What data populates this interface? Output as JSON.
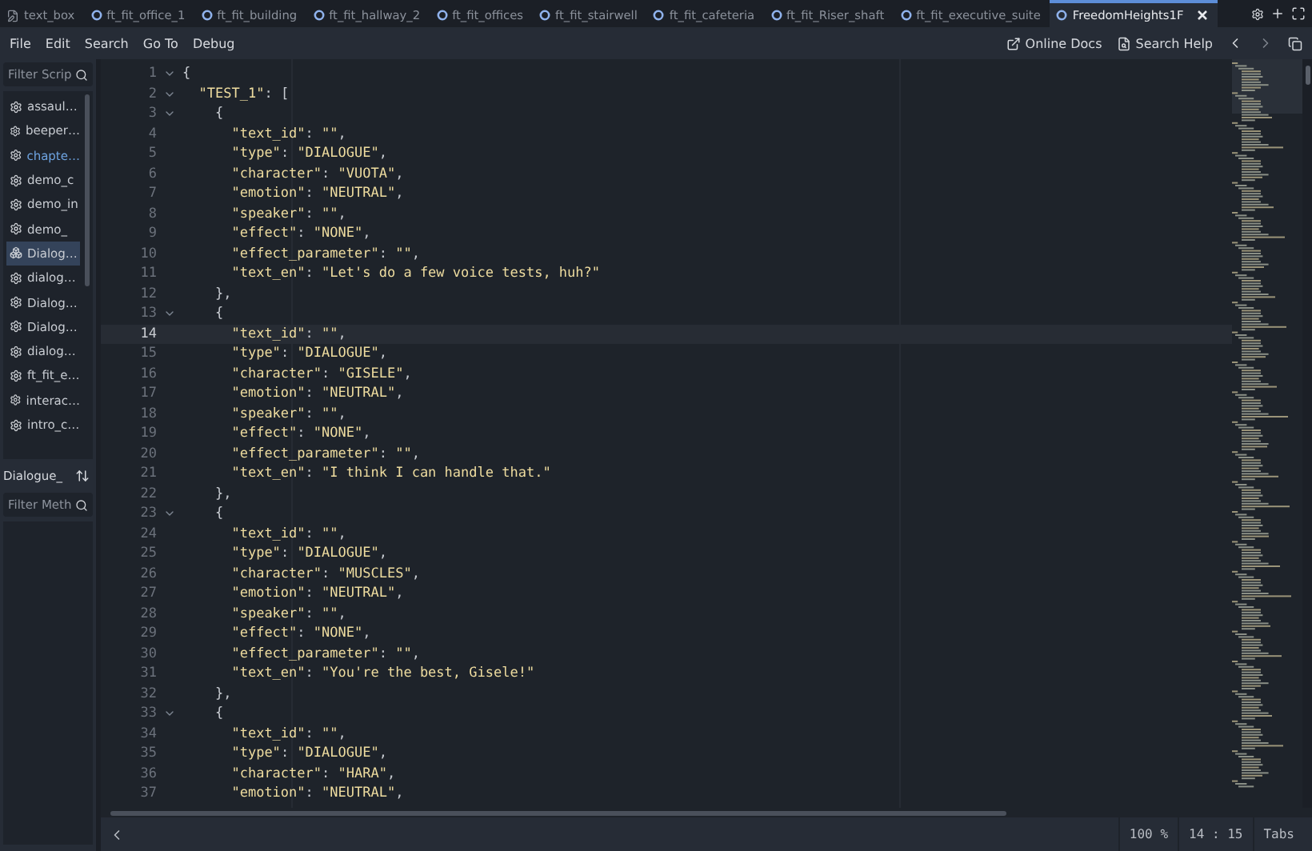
{
  "tabs": [
    {
      "label": "text_box",
      "kind": "text",
      "selected": false
    },
    {
      "label": "ft_fit_office_1",
      "kind": "json",
      "selected": false
    },
    {
      "label": "ft_fit_building",
      "kind": "json",
      "selected": false
    },
    {
      "label": "ft_fit_hallway_2",
      "kind": "json",
      "selected": false
    },
    {
      "label": "ft_fit_offices",
      "kind": "json",
      "selected": false
    },
    {
      "label": "ft_fit_stairwell",
      "kind": "json",
      "selected": false
    },
    {
      "label": "ft_fit_cafeteria",
      "kind": "json",
      "selected": false
    },
    {
      "label": "ft_fit_Riser_shaft",
      "kind": "json",
      "selected": false
    },
    {
      "label": "ft_fit_executive_suite",
      "kind": "json",
      "selected": false
    },
    {
      "label": "FreedomHeights1F",
      "kind": "json",
      "selected": true
    }
  ],
  "menu": [
    "File",
    "Edit",
    "Search",
    "Go To",
    "Debug"
  ],
  "help_links": [
    {
      "label": "Online Docs",
      "kind": "docs"
    },
    {
      "label": "Search Help",
      "kind": "help"
    }
  ],
  "sidebar": {
    "script_filter": {
      "placeholder": "Filter Scrip"
    },
    "scripts": [
      {
        "label": "assaul…",
        "kind": "script",
        "selected": false,
        "modified": false
      },
      {
        "label": "beeper…",
        "kind": "script",
        "selected": false,
        "modified": false
      },
      {
        "label": "chapte…",
        "kind": "script",
        "selected": false,
        "modified": true
      },
      {
        "label": "demo_c",
        "kind": "script",
        "selected": false,
        "modified": false
      },
      {
        "label": "demo_in",
        "kind": "script",
        "selected": false,
        "modified": false
      },
      {
        "label": "demo_",
        "kind": "script",
        "selected": false,
        "modified": false
      },
      {
        "label": "Dialog…",
        "kind": "scene",
        "selected": true,
        "modified": false
      },
      {
        "label": "dialog…",
        "kind": "script",
        "selected": false,
        "modified": false
      },
      {
        "label": "Dialog…",
        "kind": "script",
        "selected": false,
        "modified": false
      },
      {
        "label": "Dialog…",
        "kind": "script",
        "selected": false,
        "modified": false
      },
      {
        "label": "dialog…",
        "kind": "script",
        "selected": false,
        "modified": false
      },
      {
        "label": "ft_fit_e…",
        "kind": "script",
        "selected": false,
        "modified": false
      },
      {
        "label": "interac…",
        "kind": "script",
        "selected": false,
        "modified": false
      },
      {
        "label": "intro_c…",
        "kind": "script",
        "selected": false,
        "modified": false
      }
    ],
    "current_script": "Dialogue_",
    "method_filter": {
      "placeholder": "Filter Meth"
    }
  },
  "editor": {
    "lines": [
      {
        "number": "1",
        "text": "{",
        "fold": true,
        "current": false
      },
      {
        "number": "2",
        "text": "  \"TEST_1\": [",
        "fold": true,
        "current": false
      },
      {
        "number": "3",
        "text": "    {",
        "fold": true,
        "current": false
      },
      {
        "number": "4",
        "text": "      \"text_id\": \"\",",
        "fold": false,
        "current": false
      },
      {
        "number": "5",
        "text": "      \"type\": \"DIALOGUE\",",
        "fold": false,
        "current": false
      },
      {
        "number": "6",
        "text": "      \"character\": \"VUOTA\",",
        "fold": false,
        "current": false
      },
      {
        "number": "7",
        "text": "      \"emotion\": \"NEUTRAL\",",
        "fold": false,
        "current": false
      },
      {
        "number": "8",
        "text": "      \"speaker\": \"\",",
        "fold": false,
        "current": false
      },
      {
        "number": "9",
        "text": "      \"effect\": \"NONE\",",
        "fold": false,
        "current": false
      },
      {
        "number": "10",
        "text": "      \"effect_parameter\": \"\",",
        "fold": false,
        "current": false
      },
      {
        "number": "11",
        "text": "      \"text_en\": \"Let's do a few voice tests, huh?\"",
        "fold": false,
        "current": false
      },
      {
        "number": "12",
        "text": "    },",
        "fold": false,
        "current": false
      },
      {
        "number": "13",
        "text": "    {",
        "fold": true,
        "current": false
      },
      {
        "number": "14",
        "text": "      \"text_id\": \"\",",
        "fold": false,
        "current": true
      },
      {
        "number": "15",
        "text": "      \"type\": \"DIALOGUE\",",
        "fold": false,
        "current": false
      },
      {
        "number": "16",
        "text": "      \"character\": \"GISELE\",",
        "fold": false,
        "current": false
      },
      {
        "number": "17",
        "text": "      \"emotion\": \"NEUTRAL\",",
        "fold": false,
        "current": false
      },
      {
        "number": "18",
        "text": "      \"speaker\": \"\",",
        "fold": false,
        "current": false
      },
      {
        "number": "19",
        "text": "      \"effect\": \"NONE\",",
        "fold": false,
        "current": false
      },
      {
        "number": "20",
        "text": "      \"effect_parameter\": \"\",",
        "fold": false,
        "current": false
      },
      {
        "number": "21",
        "text": "      \"text_en\": \"I think I can handle that.\"",
        "fold": false,
        "current": false
      },
      {
        "number": "22",
        "text": "    },",
        "fold": false,
        "current": false
      },
      {
        "number": "23",
        "text": "    {",
        "fold": true,
        "current": false
      },
      {
        "number": "24",
        "text": "      \"text_id\": \"\",",
        "fold": false,
        "current": false
      },
      {
        "number": "25",
        "text": "      \"type\": \"DIALOGUE\",",
        "fold": false,
        "current": false
      },
      {
        "number": "26",
        "text": "      \"character\": \"MUSCLES\",",
        "fold": false,
        "current": false
      },
      {
        "number": "27",
        "text": "      \"emotion\": \"NEUTRAL\",",
        "fold": false,
        "current": false
      },
      {
        "number": "28",
        "text": "      \"speaker\": \"\",",
        "fold": false,
        "current": false
      },
      {
        "number": "29",
        "text": "      \"effect\": \"NONE\",",
        "fold": false,
        "current": false
      },
      {
        "number": "30",
        "text": "      \"effect_parameter\": \"\",",
        "fold": false,
        "current": false
      },
      {
        "number": "31",
        "text": "      \"text_en\": \"You're the best, Gisele!\"",
        "fold": false,
        "current": false
      },
      {
        "number": "32",
        "text": "    },",
        "fold": false,
        "current": false
      },
      {
        "number": "33",
        "text": "    {",
        "fold": true,
        "current": false
      },
      {
        "number": "34",
        "text": "      \"text_id\": \"\",",
        "fold": false,
        "current": false
      },
      {
        "number": "35",
        "text": "      \"type\": \"DIALOGUE\",",
        "fold": false,
        "current": false
      },
      {
        "number": "36",
        "text": "      \"character\": \"HARA\",",
        "fold": false,
        "current": false
      },
      {
        "number": "37",
        "text": "      \"emotion\": \"NEUTRAL\",",
        "fold": false,
        "current": false
      }
    ]
  },
  "status_bar": {
    "zoom": "100 %",
    "position": "14 : 15",
    "indent": "Tabs"
  }
}
